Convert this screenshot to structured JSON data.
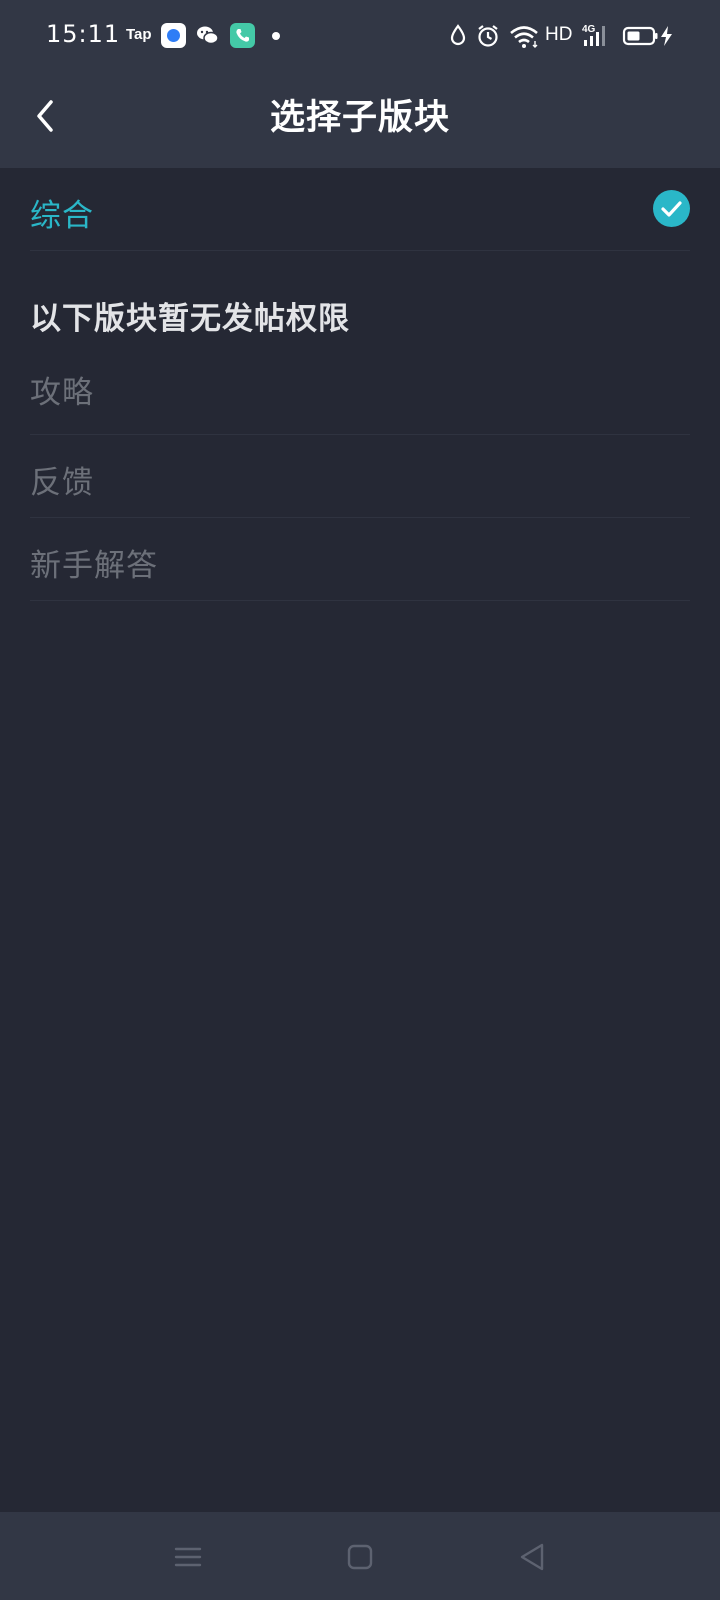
{
  "status_bar": {
    "time": "15:11",
    "tap_label": "Tap",
    "network": "HD",
    "icons": [
      "tap-app-icon",
      "blue-app-icon",
      "wechat-icon",
      "phone-app-icon",
      "notification-dot",
      "water-drop-icon",
      "alarm-icon",
      "wifi-icon",
      "signal-4g-icon",
      "battery-icon",
      "charging-icon"
    ]
  },
  "header": {
    "title": "选择子版块",
    "back_icon": "chevron-left-icon"
  },
  "selected_item": {
    "label": "综合",
    "check_icon": "check-circle-icon"
  },
  "restricted_section": {
    "title": "以下版块暂无发帖权限",
    "items": [
      {
        "label": "攻略"
      },
      {
        "label": "反馈"
      },
      {
        "label": "新手解答"
      }
    ]
  },
  "nav_bar": {
    "icons": [
      "menu-icon",
      "home-square-icon",
      "back-triangle-icon"
    ]
  },
  "colors": {
    "accent": "#2ab7c8",
    "background": "#252834",
    "bar": "#323745",
    "disabled_text": "#6c7079"
  }
}
